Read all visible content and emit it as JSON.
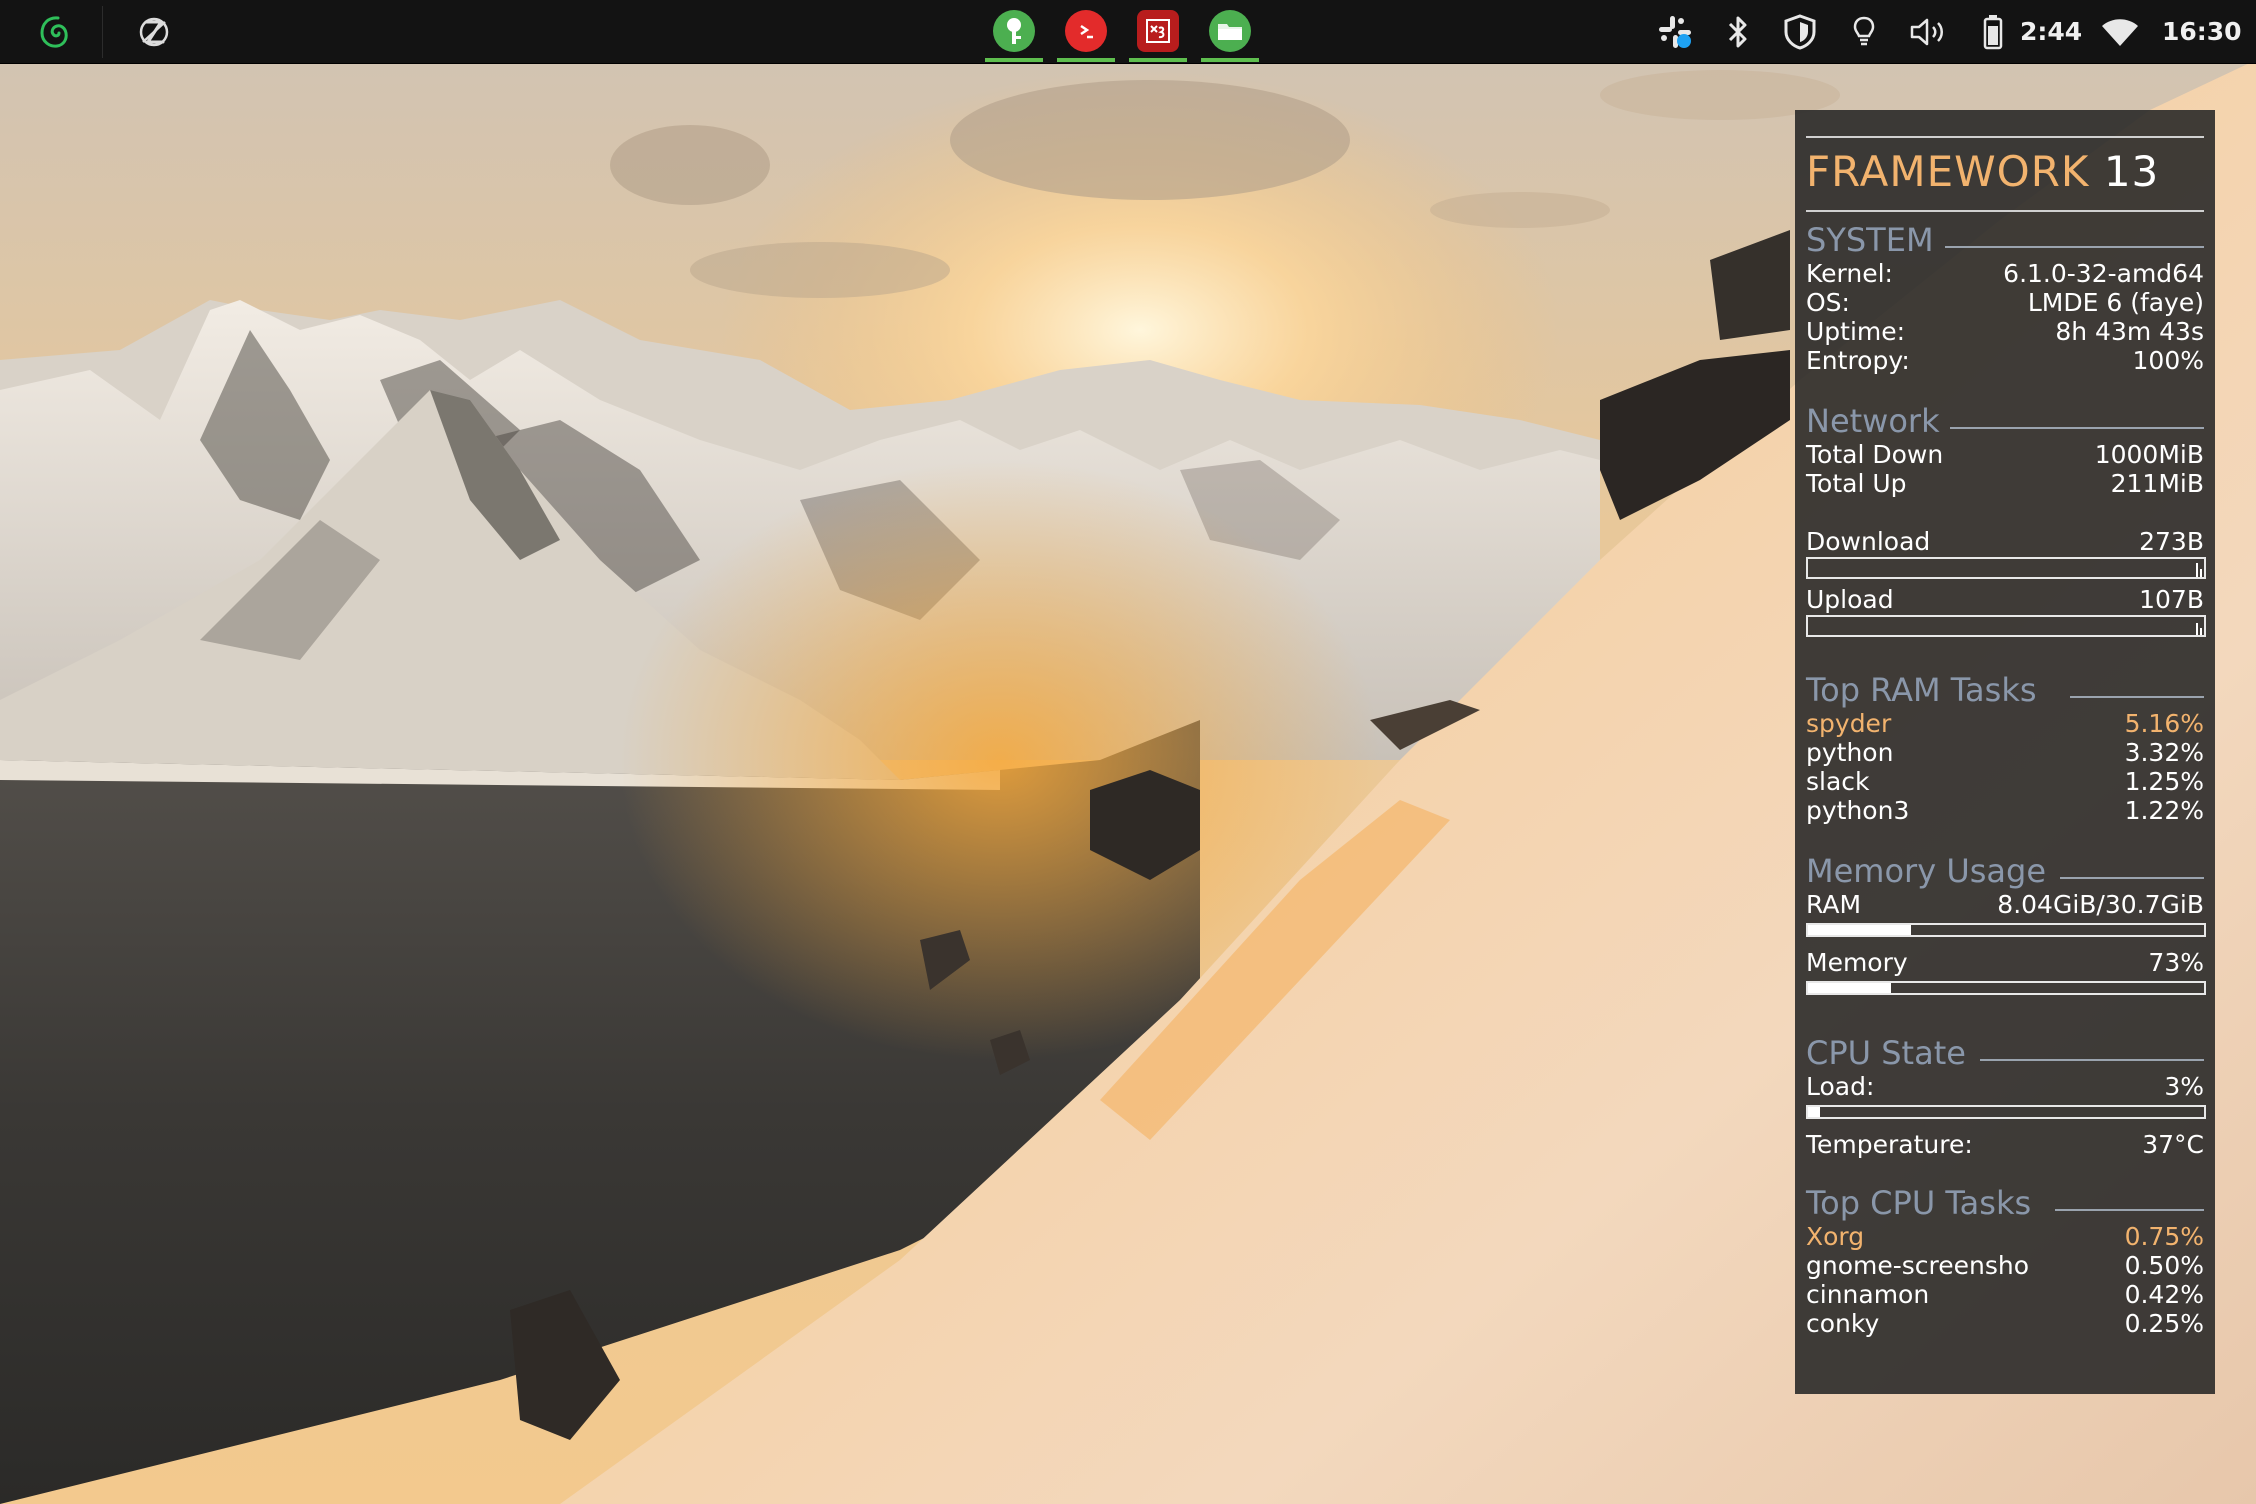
{
  "panel": {
    "apps": [
      {
        "name": "keepassxc",
        "color": "#4caf50"
      },
      {
        "name": "terminal",
        "color": "#e32b2b"
      },
      {
        "name": "xournal",
        "color": "#c81e1e"
      },
      {
        "name": "files",
        "color": "#4caf50"
      }
    ],
    "battery_time": "2:44",
    "clock": "16:30"
  },
  "conky": {
    "title_brand": "FRAMEWORK",
    "title_model": "13",
    "system": {
      "heading": "SYSTEM",
      "rows": [
        {
          "label": "Kernel:",
          "value": "6.1.0-32-amd64"
        },
        {
          "label": "OS:",
          "value": "LMDE 6 (faye)"
        },
        {
          "label": "Uptime:",
          "value": "8h 43m 43s"
        },
        {
          "label": "Entropy:",
          "value": "100%"
        }
      ]
    },
    "network": {
      "heading": "Network",
      "total_down_label": "Total Down",
      "total_down": "1000MiB",
      "total_up_label": "Total Up",
      "total_up": "211MiB",
      "download_label": "Download",
      "download": "273B",
      "upload_label": "Upload",
      "upload": "107B"
    },
    "top_ram": {
      "heading": "Top RAM Tasks",
      "rows": [
        {
          "label": "spyder",
          "value": "5.16%"
        },
        {
          "label": "python",
          "value": "3.32%"
        },
        {
          "label": "slack",
          "value": "1.25%"
        },
        {
          "label": "python3",
          "value": "1.22%"
        }
      ]
    },
    "memory": {
      "heading": "Memory Usage",
      "ram_label": "RAM",
      "ram_value": "8.04GiB/30.7GiB",
      "ram_fraction": 0.26,
      "mem_label": "Memory",
      "mem_value": "73%",
      "mem_fraction": 0.21
    },
    "cpu": {
      "heading": "CPU State",
      "load_label": "Load:",
      "load_value": "3%",
      "load_fraction": 0.03,
      "temp_label": "Temperature:",
      "temp_value": "37°C"
    },
    "top_cpu": {
      "heading": "Top CPU Tasks",
      "rows": [
        {
          "label": "Xorg",
          "value": "0.75%"
        },
        {
          "label": "gnome-screensho",
          "value": "0.50%"
        },
        {
          "label": "cinnamon",
          "value": "0.42%"
        },
        {
          "label": "conky",
          "value": "0.25%"
        }
      ]
    }
  }
}
